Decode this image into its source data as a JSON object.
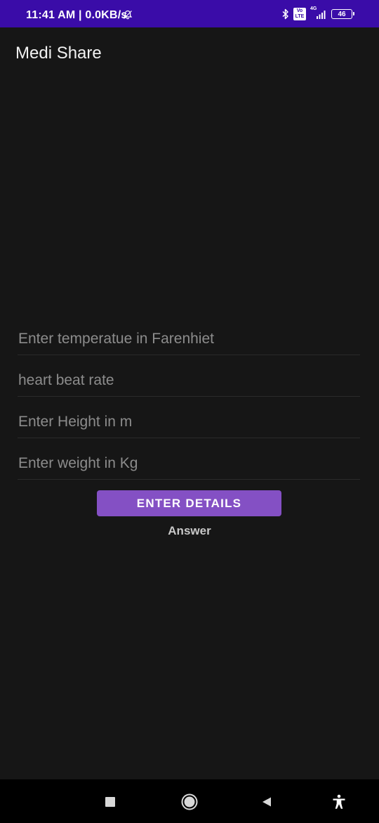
{
  "status_bar": {
    "time": "11:41 AM | 0.0KB/s",
    "battery": "46",
    "network": "4G",
    "volte": "Vo LTE",
    "background_color": "#3a0ca8"
  },
  "app": {
    "title": "Medi Share"
  },
  "form": {
    "temperature": {
      "placeholder": "Enter temperatue in Farenhiet",
      "value": ""
    },
    "heart_rate": {
      "placeholder": "heart beat rate",
      "value": ""
    },
    "height": {
      "placeholder": "Enter Height in m",
      "value": ""
    },
    "weight": {
      "placeholder": "Enter weight in Kg",
      "value": ""
    },
    "submit_label": "ENTER DETAILS",
    "answer_label": "Answer"
  },
  "colors": {
    "background": "#161616",
    "accent": "#8450c4",
    "nav_bar": "#000000"
  },
  "nav_bar": {
    "icons": [
      "recents-square-icon",
      "home-circle-icon",
      "back-triangle-icon",
      "accessibility-icon"
    ]
  }
}
